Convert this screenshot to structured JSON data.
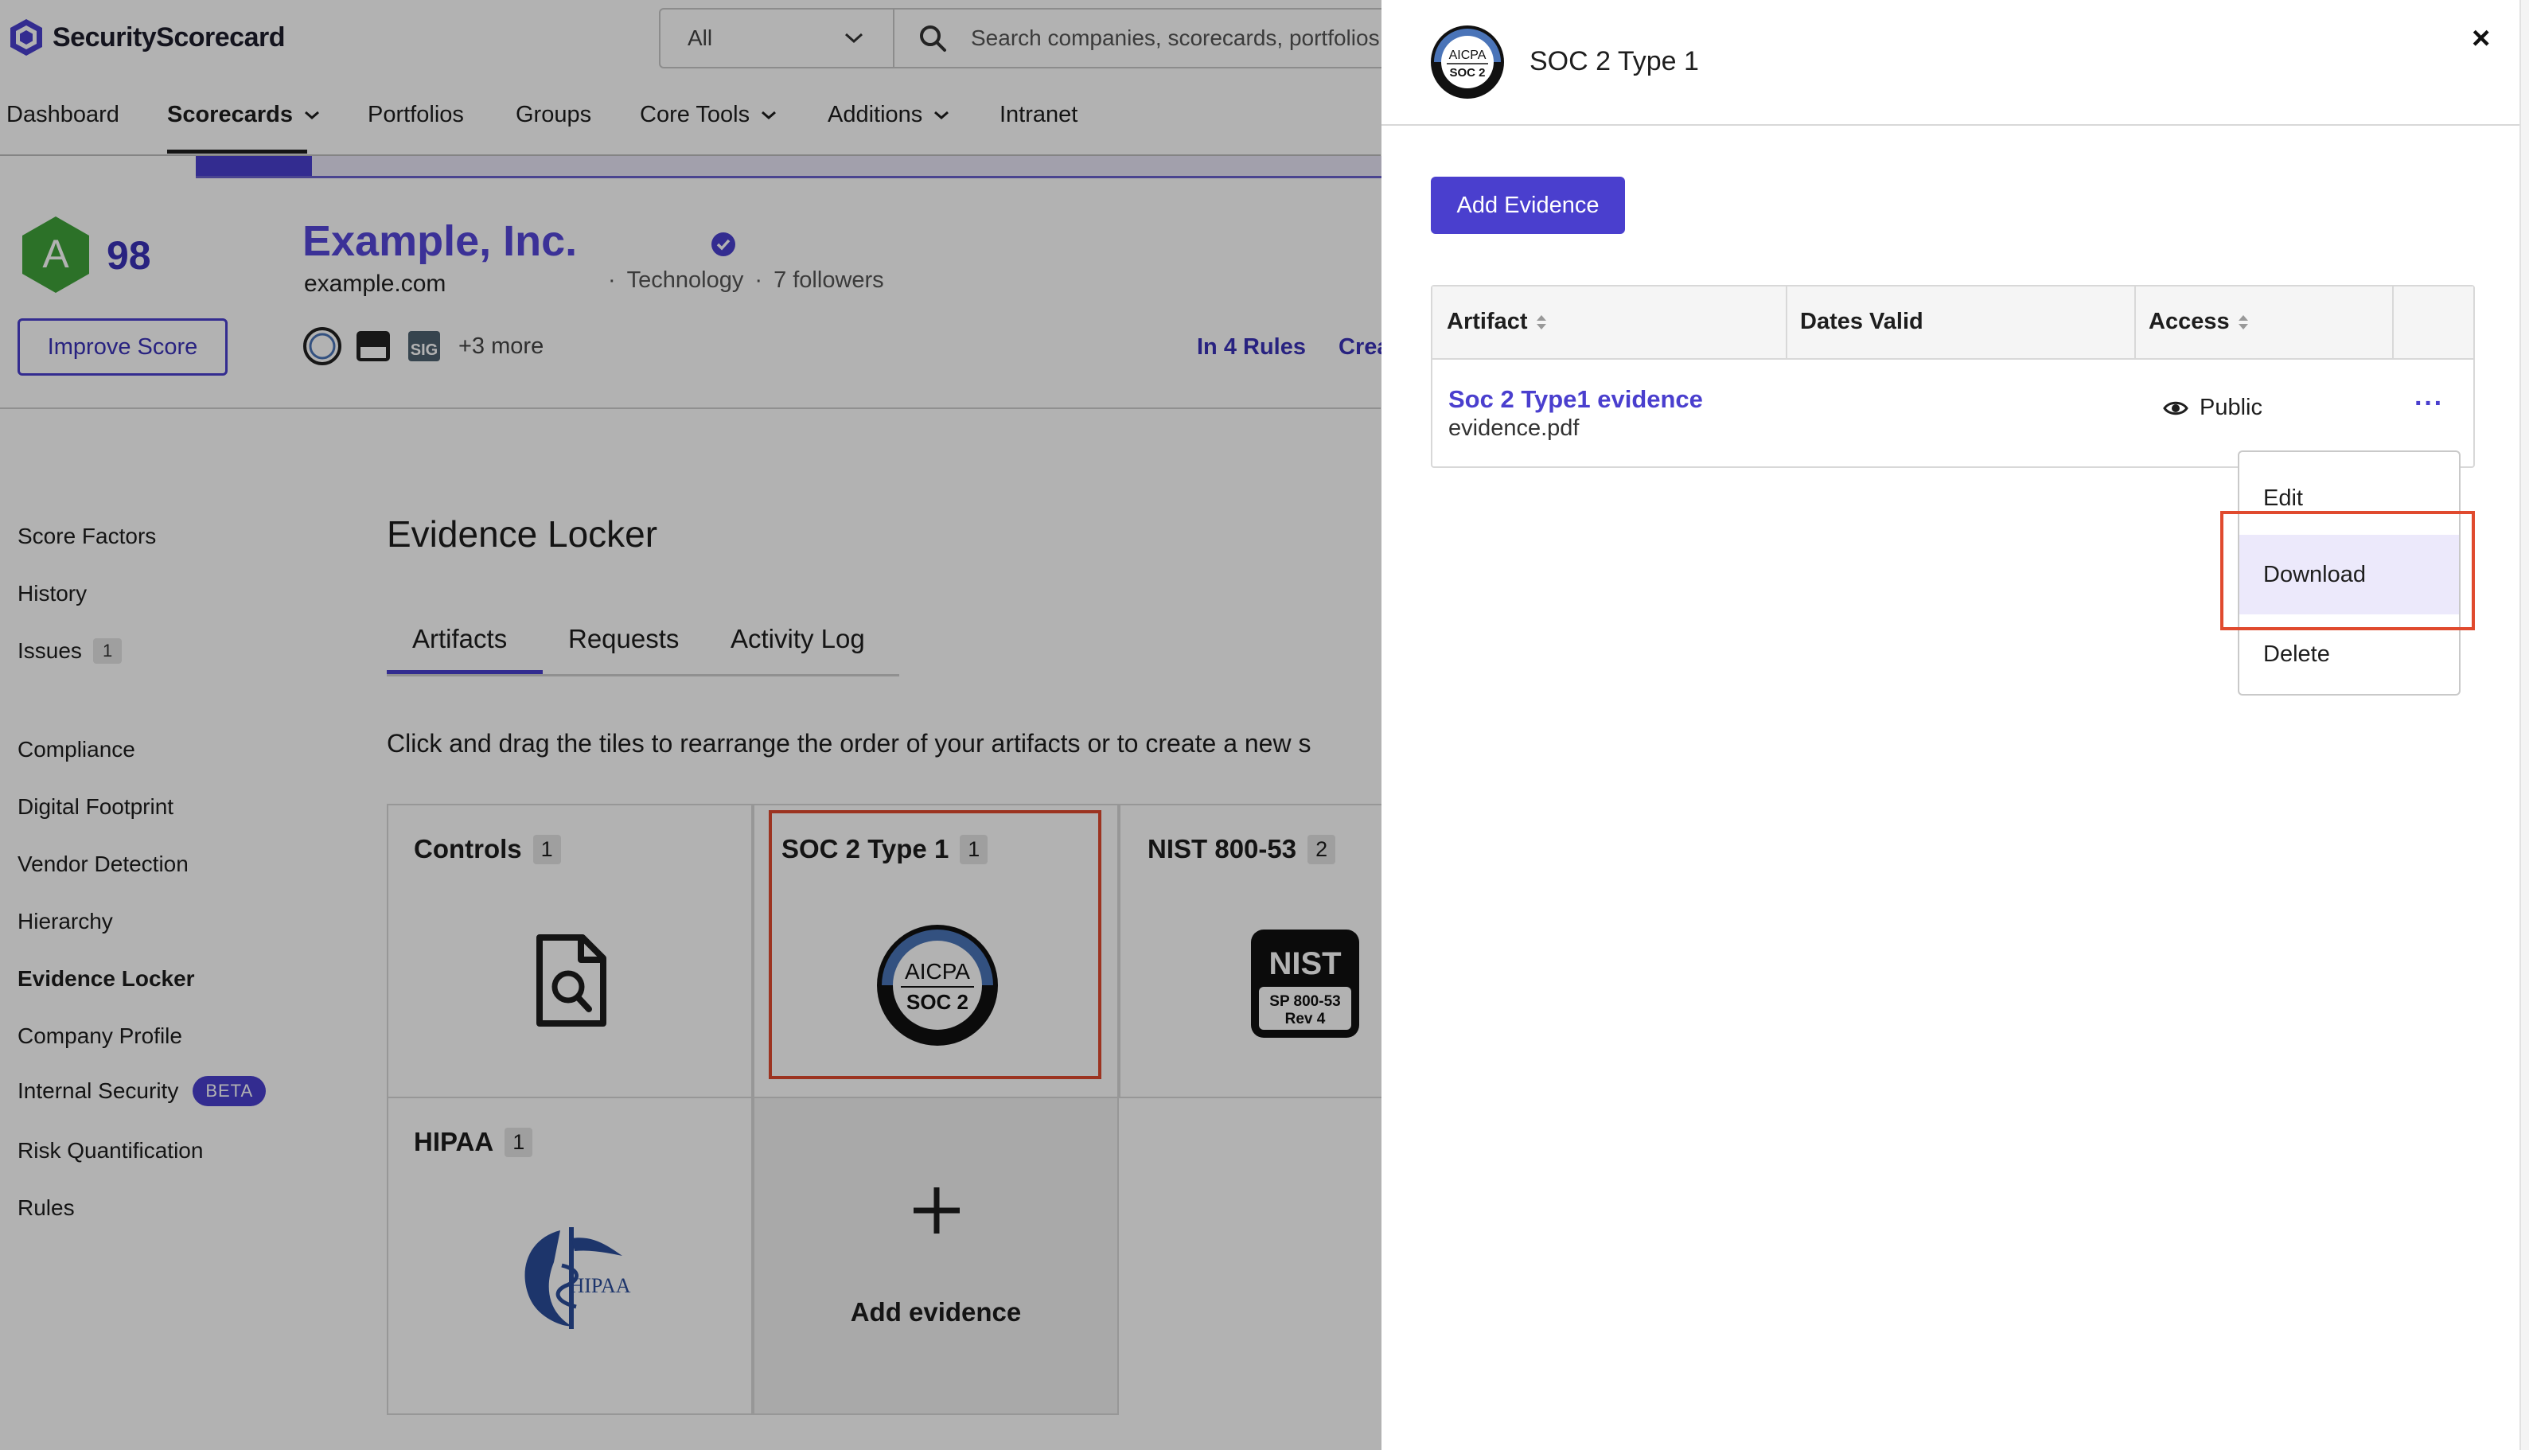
{
  "app": {
    "name": "SecurityScorecard"
  },
  "search": {
    "scope": "All",
    "placeholder": "Search companies, scorecards, portfolios"
  },
  "nav": {
    "items": [
      {
        "label": "Dashboard",
        "dropdown": false
      },
      {
        "label": "Scorecards",
        "dropdown": true,
        "active": true
      },
      {
        "label": "Portfolios",
        "dropdown": false
      },
      {
        "label": "Groups",
        "dropdown": false
      },
      {
        "label": "Core Tools",
        "dropdown": true
      },
      {
        "label": "Additions",
        "dropdown": true
      },
      {
        "label": "Intranet",
        "dropdown": false
      }
    ]
  },
  "company": {
    "grade": "A",
    "score": "98",
    "name": "Example, Inc.",
    "domain": "example.com",
    "industry": "Technology",
    "followers": "7 followers",
    "improve_label": "Improve Score",
    "more_badges": "+3 more",
    "rules_link": "In 4 Rules",
    "create_link": "Crea"
  },
  "sidebar": {
    "items": [
      {
        "label": "Score Factors"
      },
      {
        "label": "History"
      },
      {
        "label": "Issues",
        "count": "1"
      },
      {
        "label": "Compliance"
      },
      {
        "label": "Digital Footprint"
      },
      {
        "label": "Vendor Detection"
      },
      {
        "label": "Hierarchy"
      },
      {
        "label": "Evidence Locker",
        "active": true
      },
      {
        "label": "Company Profile"
      },
      {
        "label": "Internal Security",
        "badge": "BETA"
      },
      {
        "label": "Risk Quantification"
      },
      {
        "label": "Rules"
      }
    ]
  },
  "locker": {
    "title": "Evidence Locker",
    "tabs": [
      "Artifacts",
      "Requests",
      "Activity Log"
    ],
    "active_tab": "Artifacts",
    "help": "Click and drag the tiles to rearrange the order of your artifacts or to create a new s",
    "tiles": [
      {
        "title": "Controls",
        "count": "1",
        "icon": "document-search-icon"
      },
      {
        "title": "SOC 2 Type 1",
        "count": "1",
        "icon": "aicpa-soc2-icon"
      },
      {
        "title": "NIST 800-53",
        "count": "2",
        "icon": "nist-icon"
      },
      {
        "title": "HIPAA",
        "count": "1",
        "icon": "hipaa-icon"
      }
    ],
    "add_tile_label": "Add evidence"
  },
  "icons": {
    "aicpa": {
      "top": "AICPA",
      "bottom": "SOC 2"
    },
    "nist": {
      "top": "NIST",
      "line1": "SP 800-53",
      "line2": "Rev 4"
    },
    "hipaa": "HIPAA",
    "sig": "SIG"
  },
  "drawer": {
    "title": "SOC 2 Type 1",
    "add_button": "Add Evidence",
    "columns": [
      "Artifact",
      "Dates Valid",
      "Access"
    ],
    "row": {
      "title": "Soc 2 Type1 evidence",
      "file": "evidence.pdf",
      "dates": "",
      "access": "Public",
      "more": "···"
    },
    "menu": [
      "Edit",
      "Download",
      "Delete"
    ],
    "close": "×"
  },
  "colors": {
    "accent": "#4a3fce",
    "grade": "#3fa33a",
    "highlight": "#e04a2e"
  }
}
